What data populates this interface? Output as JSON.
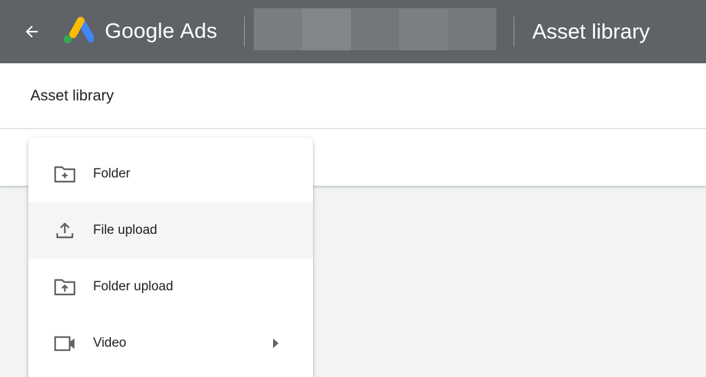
{
  "topbar": {
    "back_icon": "arrow-back-icon",
    "logo_icon": "google-ads-logo",
    "brand_google": "Google",
    "brand_ads": "Ads",
    "account_placeholder_colors": [
      "#7a7d80",
      "#838689",
      "#74777a",
      "#7d8083",
      "#76797c"
    ],
    "page_title": "Asset library"
  },
  "header": {
    "title": "Asset library"
  },
  "menu": {
    "items": [
      {
        "label": "Folder",
        "icon": "folder-add-icon"
      },
      {
        "label": "File upload",
        "icon": "upload-icon"
      },
      {
        "label": "Folder upload",
        "icon": "folder-upload-icon"
      },
      {
        "label": "Video",
        "icon": "video-camera-icon",
        "submenu": true
      }
    ]
  },
  "colors": {
    "topbar": "#5f6368",
    "icon": "#5f6368",
    "text": "#202124",
    "logo_blue": "#4285f4",
    "logo_yellow": "#fbbc04",
    "logo_green": "#34a853"
  }
}
